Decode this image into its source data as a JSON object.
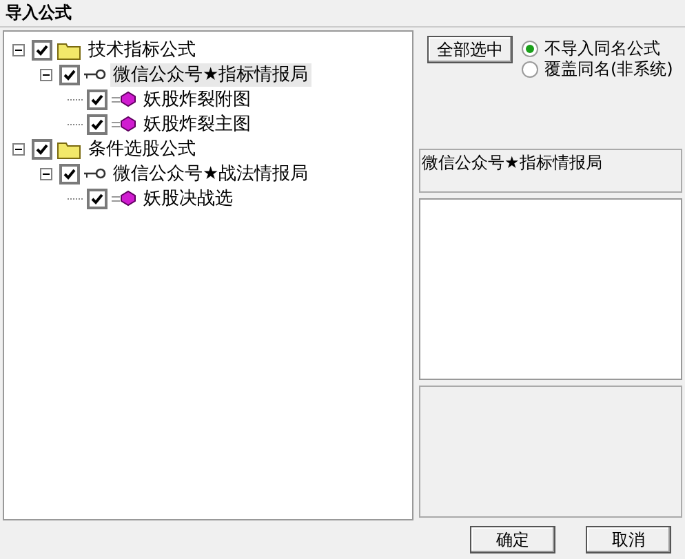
{
  "window": {
    "title": "导入公式"
  },
  "tree": [
    {
      "label": "技术指标公式",
      "kind": "folder",
      "checked": true,
      "expanded": true,
      "selected": false,
      "children": [
        {
          "label": "微信公众号★指标情报局",
          "kind": "key",
          "checked": true,
          "expanded": true,
          "selected": true,
          "children": [
            {
              "label": "妖股炸裂附图",
              "kind": "formula",
              "checked": true,
              "selected": false
            },
            {
              "label": "妖股炸裂主图",
              "kind": "formula",
              "checked": true,
              "selected": false
            }
          ]
        }
      ]
    },
    {
      "label": "条件选股公式",
      "kind": "folder",
      "checked": true,
      "expanded": true,
      "selected": false,
      "children": [
        {
          "label": "微信公众号★战法情报局",
          "kind": "key",
          "checked": true,
          "expanded": true,
          "selected": false,
          "children": [
            {
              "label": "妖股决战选",
              "kind": "formula",
              "checked": true,
              "selected": false
            }
          ]
        }
      ]
    }
  ],
  "select_all_button": "全部选中",
  "options": [
    {
      "label": "不导入同名公式",
      "selected": true
    },
    {
      "label": "覆盖同名(非系统)",
      "selected": false
    }
  ],
  "info_label": "微信公众号★指标情报局",
  "buttons": [
    "确定",
    "取消"
  ]
}
